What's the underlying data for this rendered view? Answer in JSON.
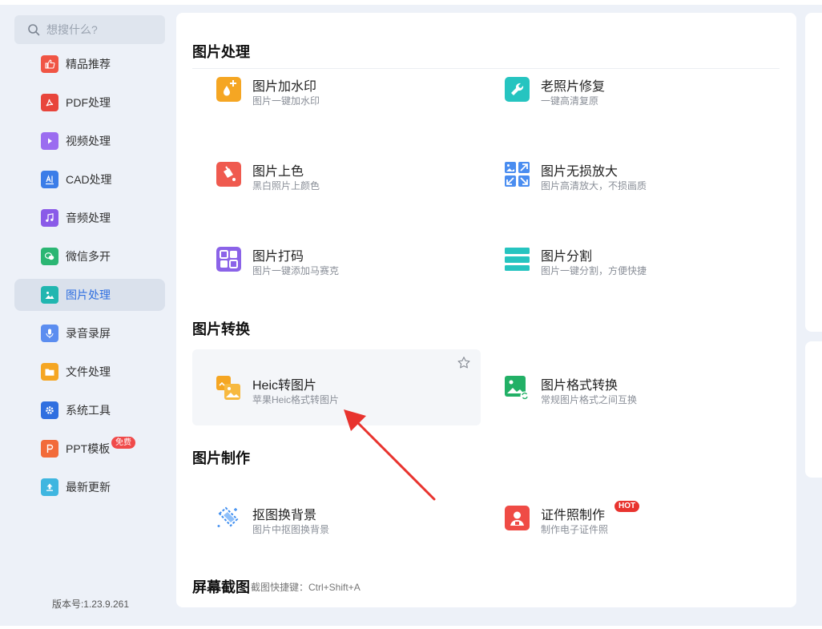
{
  "search": {
    "placeholder": "想搜什么?"
  },
  "sidebar": {
    "items": [
      {
        "label": "精品推荐",
        "icon": "thumbs-up-icon",
        "color": "#f05545",
        "active": false
      },
      {
        "label": "PDF处理",
        "icon": "pdf-icon",
        "color": "#e8453c",
        "active": false
      },
      {
        "label": "视频处理",
        "icon": "play-icon",
        "color": "#9b6cf0",
        "active": false
      },
      {
        "label": "CAD处理",
        "icon": "cad-icon",
        "color": "#3b7de8",
        "active": false
      },
      {
        "label": "音频处理",
        "icon": "music-icon",
        "color": "#8a5ae8",
        "active": false
      },
      {
        "label": "微信多开",
        "icon": "wechat-icon",
        "color": "#2bb673",
        "active": false
      },
      {
        "label": "图片处理",
        "icon": "image-icon",
        "color": "#21b6b0",
        "active": true
      },
      {
        "label": "录音录屏",
        "icon": "microphone-icon",
        "color": "#5b8df0",
        "active": false
      },
      {
        "label": "文件处理",
        "icon": "folder-icon",
        "color": "#f5a623",
        "active": false
      },
      {
        "label": "系统工具",
        "icon": "gear-icon",
        "color": "#2f6fe0",
        "active": false
      },
      {
        "label": "PPT模板",
        "icon": "ppt-icon",
        "color": "#f26b3a",
        "active": false,
        "badge": "免费"
      },
      {
        "label": "最新更新",
        "icon": "upload-icon",
        "color": "#3fb6e0",
        "active": false
      }
    ],
    "version": "版本号:1.23.9.261"
  },
  "main": {
    "sections": {
      "image_processing": "图片处理",
      "image_conversion": "图片转换",
      "image_making": "图片制作",
      "screenshot": "屏幕截图",
      "screenshot_hint": "截图快捷键：Ctrl+Shift+A"
    },
    "tools": {
      "watermark": {
        "title": "图片加水印",
        "desc": "图片一键加水印",
        "icon": "watermark-icon",
        "color": "#f5a623"
      },
      "old_photo": {
        "title": "老照片修复",
        "desc": "一键高清复原",
        "icon": "wrench-icon",
        "color": "#26c4c0"
      },
      "colorize": {
        "title": "图片上色",
        "desc": "黑白照片上颜色",
        "icon": "paint-bucket-icon",
        "color": "#ef5a4f"
      },
      "enlarge": {
        "title": "图片无损放大",
        "desc": "图片高清放大，不损画质",
        "icon": "enlarge-icon",
        "color": "#4a8df0"
      },
      "mosaic": {
        "title": "图片打码",
        "desc": "图片一键添加马赛克",
        "icon": "mosaic-icon",
        "color": "#8b63e8"
      },
      "split": {
        "title": "图片分割",
        "desc": "图片一键分割，方便快捷",
        "icon": "split-icon",
        "color": "#26c4c0"
      },
      "heic": {
        "title": "Heic转图片",
        "desc": "苹果Heic格式转图片",
        "icon": "heic-convert-icon",
        "color": "#f5a623"
      },
      "format": {
        "title": "图片格式转换",
        "desc": "常规图片格式之间互换",
        "icon": "format-convert-icon",
        "color": "#22b066"
      },
      "cutout": {
        "title": "抠图换背景",
        "desc": "图片中抠图换背景",
        "icon": "cutout-icon",
        "color": "#3f8ef0"
      },
      "id_photo": {
        "title": "证件照制作",
        "desc": "制作电子证件照",
        "icon": "id-photo-icon",
        "color": "#ef4b45",
        "badge": "HOT"
      }
    }
  }
}
